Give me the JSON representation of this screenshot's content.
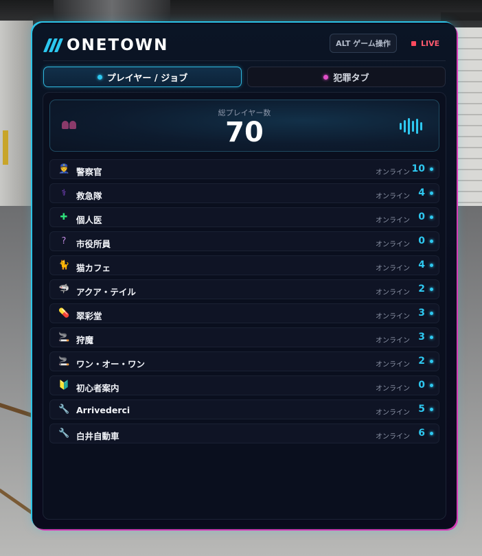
{
  "app": {
    "title": "ONETOWN",
    "alt_button": "ALT ゲーム操作",
    "live_label": "LIVE"
  },
  "tabs": [
    {
      "label": "プレイヤー / ジョブ",
      "dot_color": "#2ec8f0",
      "active": true
    },
    {
      "label": "犯罪タブ",
      "dot_color": "#e04fc8",
      "active": false
    }
  ],
  "summary": {
    "label": "総プレイヤー数",
    "total": "70",
    "icon_left": "people-icon",
    "icon_right": "soundwave-icon"
  },
  "jobs": [
    {
      "icon": "police-officer-icon",
      "glyph": "👮",
      "name": "警察官",
      "status": "オンライン",
      "count": "10"
    },
    {
      "icon": "stethoscope-icon",
      "glyph": "⚕",
      "name": "救急隊",
      "status": "オンライン",
      "count": "4"
    },
    {
      "icon": "cross-icon",
      "glyph": "✚",
      "name": "個人医",
      "status": "オンライン",
      "count": "0"
    },
    {
      "icon": "question-icon",
      "glyph": "?",
      "name": "市役所員",
      "status": "オンライン",
      "count": "0"
    },
    {
      "icon": "cat-icon",
      "glyph": "🐈",
      "name": "猫カフェ",
      "status": "オンライン",
      "count": "4"
    },
    {
      "icon": "shark-icon",
      "glyph": "🦈",
      "name": "アクア・テイル",
      "status": "オンライン",
      "count": "2"
    },
    {
      "icon": "pill-icon",
      "glyph": "💊",
      "name": "翠彩堂",
      "status": "オンライン",
      "count": "3"
    },
    {
      "icon": "cigarette-icon",
      "glyph": "🚬",
      "name": "狩魔",
      "status": "オンライン",
      "count": "3"
    },
    {
      "icon": "cigarette-icon",
      "glyph": "🚬",
      "name": "ワン・オー・ワン",
      "status": "オンライン",
      "count": "2"
    },
    {
      "icon": "beginner-mark-icon",
      "glyph": "🔰",
      "name": "初心者案内",
      "status": "オンライン",
      "count": "0"
    },
    {
      "icon": "wrench-icon",
      "glyph": "🔧",
      "name": "Arrivederci",
      "status": "オンライン",
      "count": "5"
    },
    {
      "icon": "wrench-icon",
      "glyph": "🔧",
      "name": "白井自動車",
      "status": "オンライン",
      "count": "6"
    }
  ],
  "colors": {
    "accent": "#2ec8f0",
    "accent_pink": "#d63bb8",
    "live": "#ff4a5e",
    "panel_bg": "#0a0f1e"
  }
}
